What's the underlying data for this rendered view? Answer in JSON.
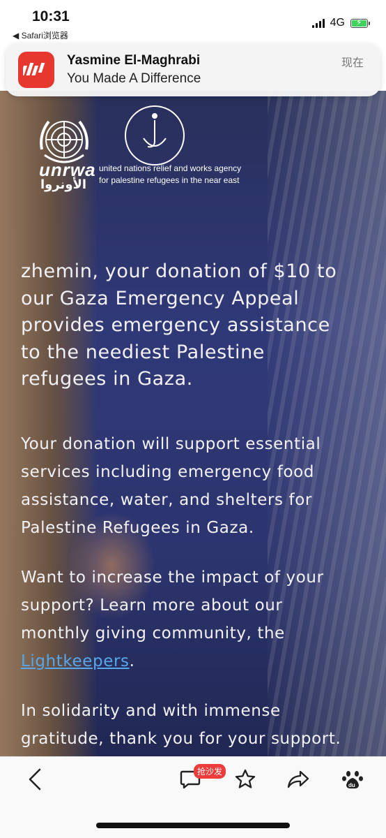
{
  "status_bar": {
    "time": "10:31",
    "back_app": "◀ Safari浏览器",
    "network": "4G",
    "battery_color": "#3fd25c"
  },
  "notification": {
    "app_icon": "weibo-style-app-icon",
    "sender": "Yasmine El-Maghrabi",
    "subject": "You Made A Difference",
    "time": "现在",
    "icon_color": "#e6382f"
  },
  "email": {
    "logo_text": "unrwa",
    "logo_arabic": "الأونروا",
    "org_line1": "united nations relief and works agency",
    "org_line2": "for palestine refugees in the near east",
    "para1": "zhemin, your donation of $10 to our Gaza Emergency Appeal provides emergency assistance to the neediest Palestine refugees in Gaza.",
    "para2": "Your donation will support essential services including emergency food assistance, water, and shelters for Palestine Refugees in Gaza.",
    "para3_before_link": "Want to increase the impact of your support? Learn more about our monthly giving community, the ",
    "para3_link": "Lightkeepers",
    "para3_after_link": ".",
    "para4": "In solidarity and with immense gratitude, thank you for your support.",
    "link_color": "#57a7ea"
  },
  "toolbar": {
    "comment_badge": "抢沙发",
    "icons": [
      "back-icon",
      "comment-icon",
      "star-icon",
      "share-icon",
      "baidu-paw-icon"
    ]
  }
}
